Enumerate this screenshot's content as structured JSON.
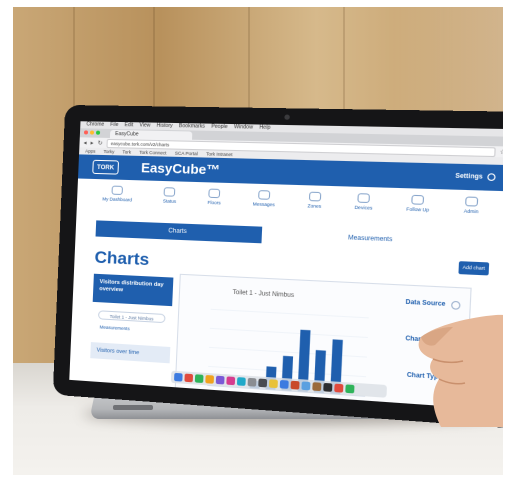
{
  "browser": {
    "menu": [
      "Chrome",
      "File",
      "Edit",
      "View",
      "History",
      "Bookmarks",
      "People",
      "Window",
      "Help"
    ],
    "tab_title": "EasyCube",
    "url": "easycube.tork.com/v2/charts",
    "bookmarks": [
      "Apps",
      "Torky",
      "Tork",
      "Tork Connect",
      "SCA Portal",
      "Tork Intranet"
    ]
  },
  "app": {
    "logo": "TORK",
    "title": "EasyCube™",
    "settings_label": "Settings"
  },
  "nav": {
    "items": [
      {
        "label": "My Dashboard",
        "icon": "dashboard-icon"
      },
      {
        "label": "Status",
        "icon": "status-icon"
      },
      {
        "label": "Floors",
        "icon": "floors-icon"
      },
      {
        "label": "Messages",
        "icon": "messages-icon"
      },
      {
        "label": "Zones",
        "icon": "zones-icon"
      },
      {
        "label": "Devices",
        "icon": "devices-icon"
      },
      {
        "label": "Follow Up",
        "icon": "follow-up-icon"
      },
      {
        "label": "Admin",
        "icon": "admin-icon"
      }
    ]
  },
  "segments": {
    "active": "Charts",
    "inactive": "Measurements"
  },
  "page": {
    "title": "Charts",
    "add_chart": "Add chart"
  },
  "sidebar": {
    "card_title": "Visitors distribution day overview",
    "chip": "Toilet 1 - Just Nimbus",
    "sub_label": "Measurements",
    "card2": "Visitors over time"
  },
  "panel": {
    "chart_title": "Toilet 1 - Just Nimbus",
    "options": [
      "Data Source",
      "Chart Name",
      "Chart Type"
    ]
  },
  "chart_data": {
    "type": "bar",
    "title": "Toilet 1 - Just Nimbus",
    "values": [
      2,
      6,
      9,
      16,
      11,
      14
    ],
    "ylim": [
      0,
      20
    ]
  },
  "colors": {
    "brand_blue": "#1f5fae",
    "panel_border": "#d7dee9"
  }
}
